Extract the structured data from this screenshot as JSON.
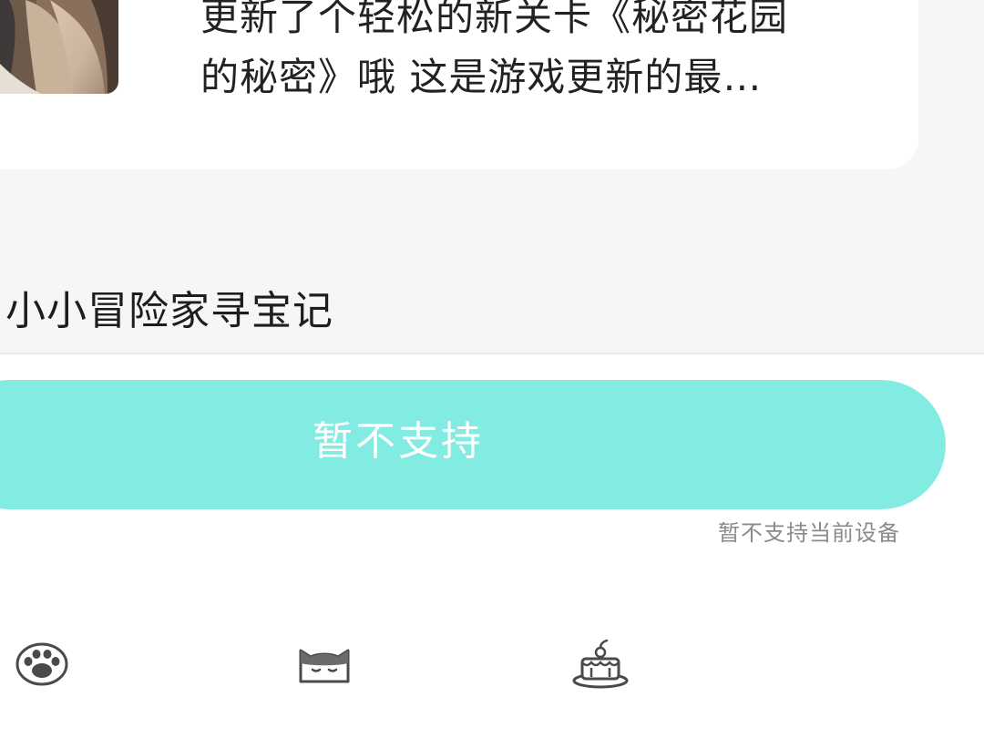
{
  "news": {
    "text_line1": "更新了个轻松的新关卡《秘密花园",
    "text_line2": "的秘密》哦 这是游戏更新的最…"
  },
  "game": {
    "title": "小小冒险家寻宝记"
  },
  "action": {
    "button_label": "暂不支持",
    "note": "暂不支持当前设备",
    "button_color": "#83ece2"
  },
  "tabs": [
    {
      "icon": "paw-icon"
    },
    {
      "icon": "cat-face-icon"
    },
    {
      "icon": "cake-icon"
    }
  ]
}
